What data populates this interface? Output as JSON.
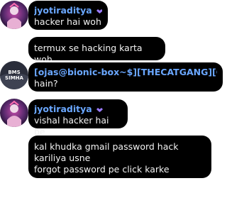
{
  "chat": {
    "groups": [
      {
        "sender": "jyotiraditya",
        "messages": [
          "hacker hai woh",
          "termux se hacking karta woh"
        ]
      },
      {
        "sender": "[ojas@bionic-box~$][THECATGANG][CYGNU...",
        "avatar_text": "BMS\nSIMHA",
        "messages": [
          "hain?"
        ]
      },
      {
        "sender": "jyotiraditya",
        "messages": [
          "vishal hacker hai be",
          "kal khudka gmail password hack kariliya usne\nforgot password pe click karke"
        ]
      }
    ]
  },
  "colors": {
    "bubble": "#000000",
    "sender_name": "#6aa7ff",
    "message_text": "#f2f2f2",
    "badge": "#9b7cff"
  },
  "icons": [
    "verified-badge-icon"
  ]
}
